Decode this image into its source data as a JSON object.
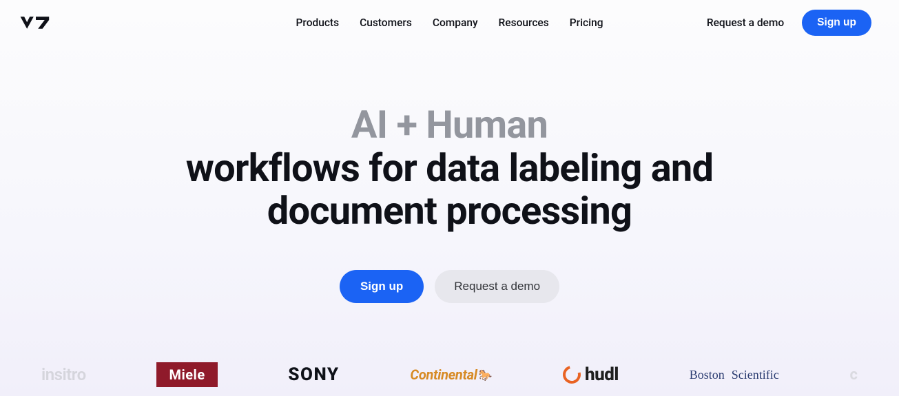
{
  "nav": {
    "items": [
      "Products",
      "Customers",
      "Company",
      "Resources",
      "Pricing"
    ],
    "request_demo": "Request a demo",
    "signup": "Sign up"
  },
  "hero": {
    "line1": "AI + Human",
    "line2": "workflows for data labeling and",
    "line3": "document processing",
    "signup": "Sign up",
    "request_demo": "Request a demo"
  },
  "brands": {
    "insitro": "insitro",
    "miele": "Miele",
    "sony": "SONY",
    "continental": "Continental",
    "hudl": "hudl",
    "boston_line1_a": "Boston",
    "boston_line2": "Scientific",
    "cut": "c"
  }
}
